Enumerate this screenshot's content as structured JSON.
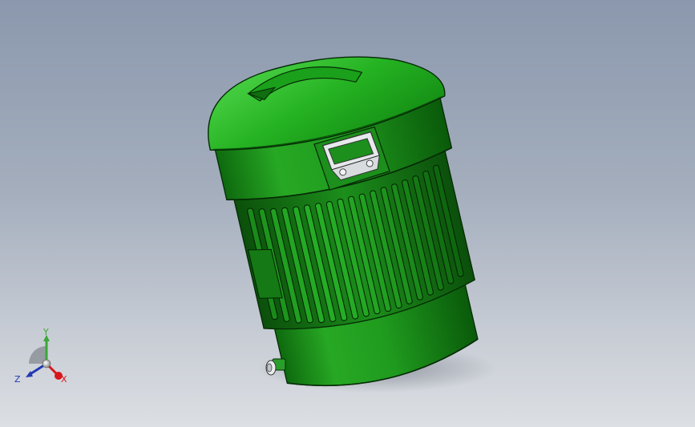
{
  "viewport": {
    "background_top": "#8b98ad",
    "background_bottom": "#dcdfe3"
  },
  "model": {
    "body_color": "#1f9e1f",
    "body_dark": "#0d5f0d",
    "body_light": "#3fcf3a",
    "edge_color": "#062a06"
  },
  "triad": {
    "x_label": "X",
    "y_label": "Y",
    "z_label": "Z",
    "x_color": "#d8161b",
    "y_color": "#3aa836",
    "z_color": "#2338b4"
  }
}
